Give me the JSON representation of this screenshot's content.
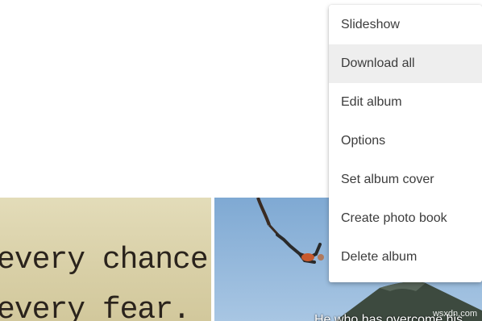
{
  "menu": {
    "items": [
      {
        "label": "Slideshow"
      },
      {
        "label": "Download all",
        "highlighted": true
      },
      {
        "label": "Edit album"
      },
      {
        "label": "Options"
      },
      {
        "label": "Set album cover"
      },
      {
        "label": "Create photo book"
      },
      {
        "label": "Delete album"
      }
    ]
  },
  "photos": {
    "quote": {
      "line1": "every chance.",
      "line2": "every fear."
    },
    "bungee": {
      "caption": "He who has overcome his"
    }
  },
  "watermark": "wsxdn.com",
  "colors": {
    "menu_background": "#ffffff",
    "menu_highlight": "#eeeeee",
    "menu_text": "#3c3c3c",
    "sky": "#8fb5da"
  }
}
